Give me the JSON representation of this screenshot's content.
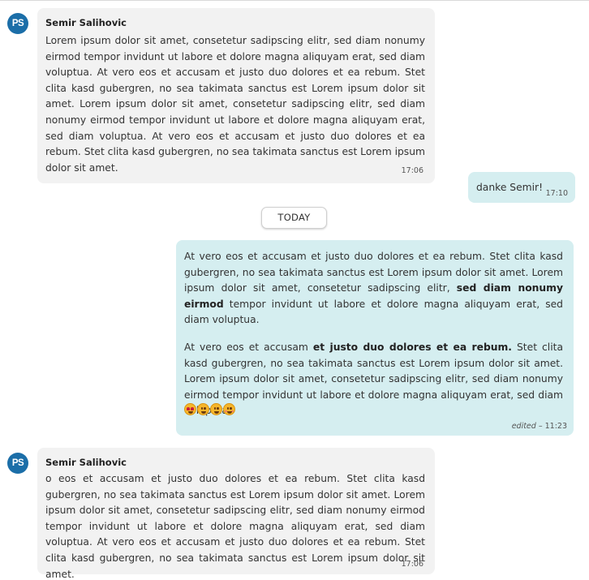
{
  "messages": [
    {
      "direction": "incoming",
      "avatar": "PS",
      "sender": "Semir Salihovic",
      "paragraphs": [
        [
          {
            "text": "Lorem ipsum dolor sit amet, consetetur sadipscing elitr, sed diam nonumy eirmod tempor invidunt ut labore et dolore magna aliquyam erat, sed diam voluptua. At vero eos et accusam et justo duo dolores et ea rebum. Stet clita kasd gubergren, no sea takimata sanctus est Lorem ipsum dolor sit amet. Lorem ipsum dolor sit amet, consetetur sadipscing elitr, sed diam nonumy eirmod tempor invidunt ut labore et dolore magna aliquyam erat, sed diam voluptua. At vero eos et accusam et justo duo dolores et ea rebum. Stet clita kasd gubergren, no sea takimata sanctus est Lorem ipsum dolor sit amet.",
            "bold": false
          }
        ]
      ],
      "time": "17:06"
    },
    {
      "direction": "outgoing",
      "paragraphs": [
        [
          {
            "text": "danke Semir!",
            "bold": false
          }
        ]
      ],
      "time": "17:10"
    },
    {
      "direction": "outgoing",
      "paragraphs": [
        [
          {
            "text": "At vero eos et accusam et justo duo dolores et ea rebum. Stet clita kasd gubergren, no sea takimata sanctus est Lorem ipsum dolor sit amet. Lorem ipsum dolor sit amet, consetetur sadipscing elitr, ",
            "bold": false
          },
          {
            "text": "sed diam nonumy eirmod",
            "bold": true
          },
          {
            "text": " tempor invidunt ut labore et dolore magna aliquyam erat, sed diam voluptua.",
            "bold": false
          }
        ],
        [
          {
            "text": "At vero eos et accusam ",
            "bold": false
          },
          {
            "text": "et justo duo dolores et ea rebum.",
            "bold": true
          },
          {
            "text": " Stet clita kasd gubergren, no sea takimata sanctus est Lorem ipsum dolor sit amet. Lorem ipsum dolor sit amet, consetetur sadipscing elitr, sed diam nonumy eirmod tempor invidunt ut labore et dolore magna aliquyam erat, sed diam voluptua.",
            "bold": false
          }
        ]
      ],
      "emojis": [
        "heart-eyes-emoji",
        "grinning-emoji",
        "grinning-squint-emoji",
        "blushing-emoji"
      ],
      "edited_label": "edited",
      "time": "11:23"
    },
    {
      "direction": "incoming",
      "avatar": "PS",
      "sender": "Semir Salihovic",
      "paragraphs": [
        [
          {
            "text": "o eos et accusam et justo duo dolores et ea rebum. Stet clita kasd gubergren, no sea takimata sanctus est Lorem ipsum dolor sit amet. Lorem ipsum dolor sit amet, consetetur sadipscing elitr, sed diam nonumy eirmod tempor invidunt ut labore et dolore magna aliquyam erat, sed diam voluptua. At vero eos et accusam et justo duo dolores et ea rebum. Stet clita kasd gubergren, no sea takimata sanctus est Lorem ipsum dolor sit amet.",
            "bold": false
          }
        ]
      ],
      "time": "17:06"
    }
  ],
  "date_separator": "TODAY",
  "colors": {
    "incoming_bubble": "#f2f2f2",
    "outgoing_bubble": "#d5eef0",
    "avatar": "#1b6ea8"
  }
}
